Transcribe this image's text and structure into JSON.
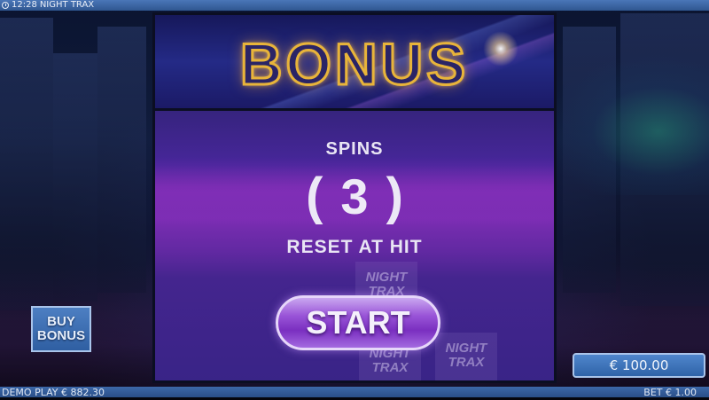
{
  "top_bar": {
    "time": "12:28",
    "game_title": "NIGHT TRAX"
  },
  "bonus_panel": {
    "title": "BONUS",
    "spins_label": "SPINS",
    "spins_open_paren": "(",
    "spins_count": "3",
    "spins_close_paren": ")",
    "reset_label": "RESET AT HIT",
    "logo_text": "NIGHT\nTRAX",
    "start_label": "START"
  },
  "buy_bonus": {
    "label": "BUY\nBONUS"
  },
  "bet_box": {
    "value": "€ 100.00"
  },
  "bottom_bar": {
    "balance_label": "DEMO PLAY € 882.30",
    "bet_label": "BET € 1.00"
  }
}
